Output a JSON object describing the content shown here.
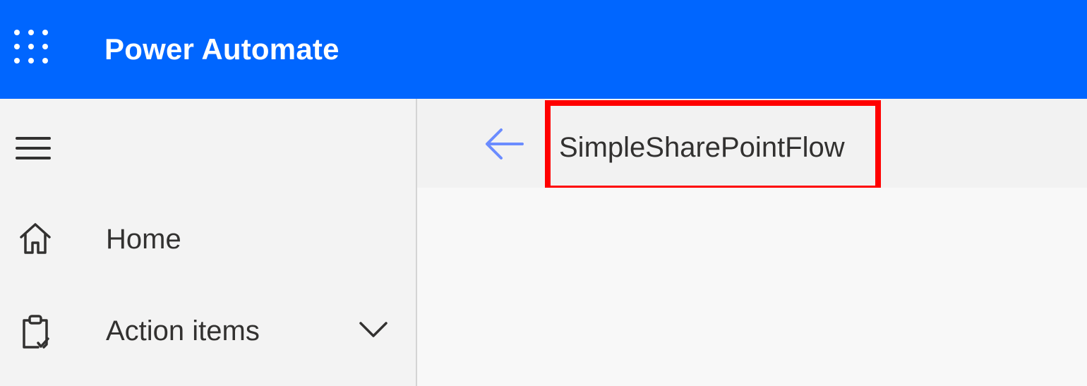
{
  "topbar": {
    "app_title": "Power Automate",
    "background_color": "#0066ff",
    "waffle_icon": "app-launcher-icon"
  },
  "sidebar": {
    "menu_icon": "hamburger-menu-icon",
    "items": [
      {
        "label": "Home",
        "icon": "home-icon"
      },
      {
        "label": "Action items",
        "icon": "clipboard-icon",
        "expand_icon": "chevron-down-icon"
      }
    ]
  },
  "header": {
    "back_icon": "back-arrow-icon",
    "flow_name": "SimpleSharePointFlow",
    "highlight_color": "#ff0000"
  }
}
